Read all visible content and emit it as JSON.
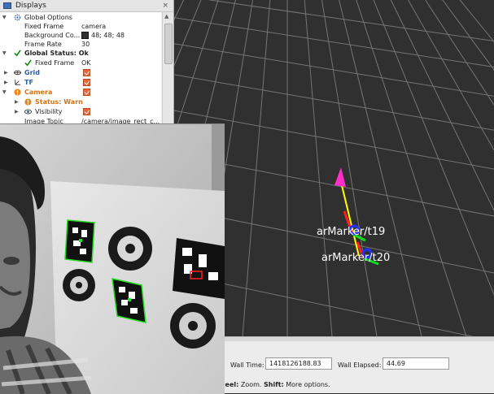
{
  "displays_panel": {
    "title": "Displays",
    "close_glyph": "×",
    "items": [
      {
        "label": "Global Options",
        "icon": "gear-icon"
      },
      {
        "label": "Fixed Frame",
        "value": "camera"
      },
      {
        "label": "Background Co...",
        "value": "48; 48; 48"
      },
      {
        "label": "Frame Rate",
        "value": "30"
      },
      {
        "label": "Global Status: Ok",
        "icon": "check-icon"
      },
      {
        "label": "Fixed Frame",
        "value": "OK",
        "icon": "check-icon"
      },
      {
        "label": "Grid",
        "icon": "grid-icon",
        "checked": true
      },
      {
        "label": "TF",
        "icon": "tf-icon",
        "checked": true
      },
      {
        "label": "Camera",
        "icon": "warning-icon",
        "checked": true
      },
      {
        "label": "Status: Warn",
        "icon": "warning-icon"
      },
      {
        "label": "Visibility",
        "icon": "eye-icon",
        "checked": true
      },
      {
        "label": "Image Topic",
        "value": "/camera/image_rect_c..."
      }
    ]
  },
  "view3d": {
    "background": "#303030",
    "grid_color": "#8c8c8c",
    "markers": [
      {
        "label": "arMarker/t19"
      },
      {
        "label": "arMarker/t20"
      }
    ]
  },
  "time_panel": {
    "wall_time_label": "Wall Time:",
    "wall_time_value": "1418126188.83",
    "wall_elapsed_label": "Wall Elapsed:",
    "wall_elapsed_value": "44.69",
    "hint_prefix": "Wheel:",
    "hint_zoom": " Zoom. ",
    "hint_shift": "Shift:",
    "hint_more": " More options."
  },
  "colors": {
    "accent_orange": "#e8673a",
    "status_blue": "#2b5ea5",
    "warn_orange": "#d4720f",
    "marker_detect_green": "#22dd22",
    "axis_red": "#ff2020",
    "axis_green": "#10dd20",
    "axis_blue": "#2030ff",
    "tf_link_yellow": "#ffff00",
    "tf_root_magenta": "#ff30c8"
  }
}
